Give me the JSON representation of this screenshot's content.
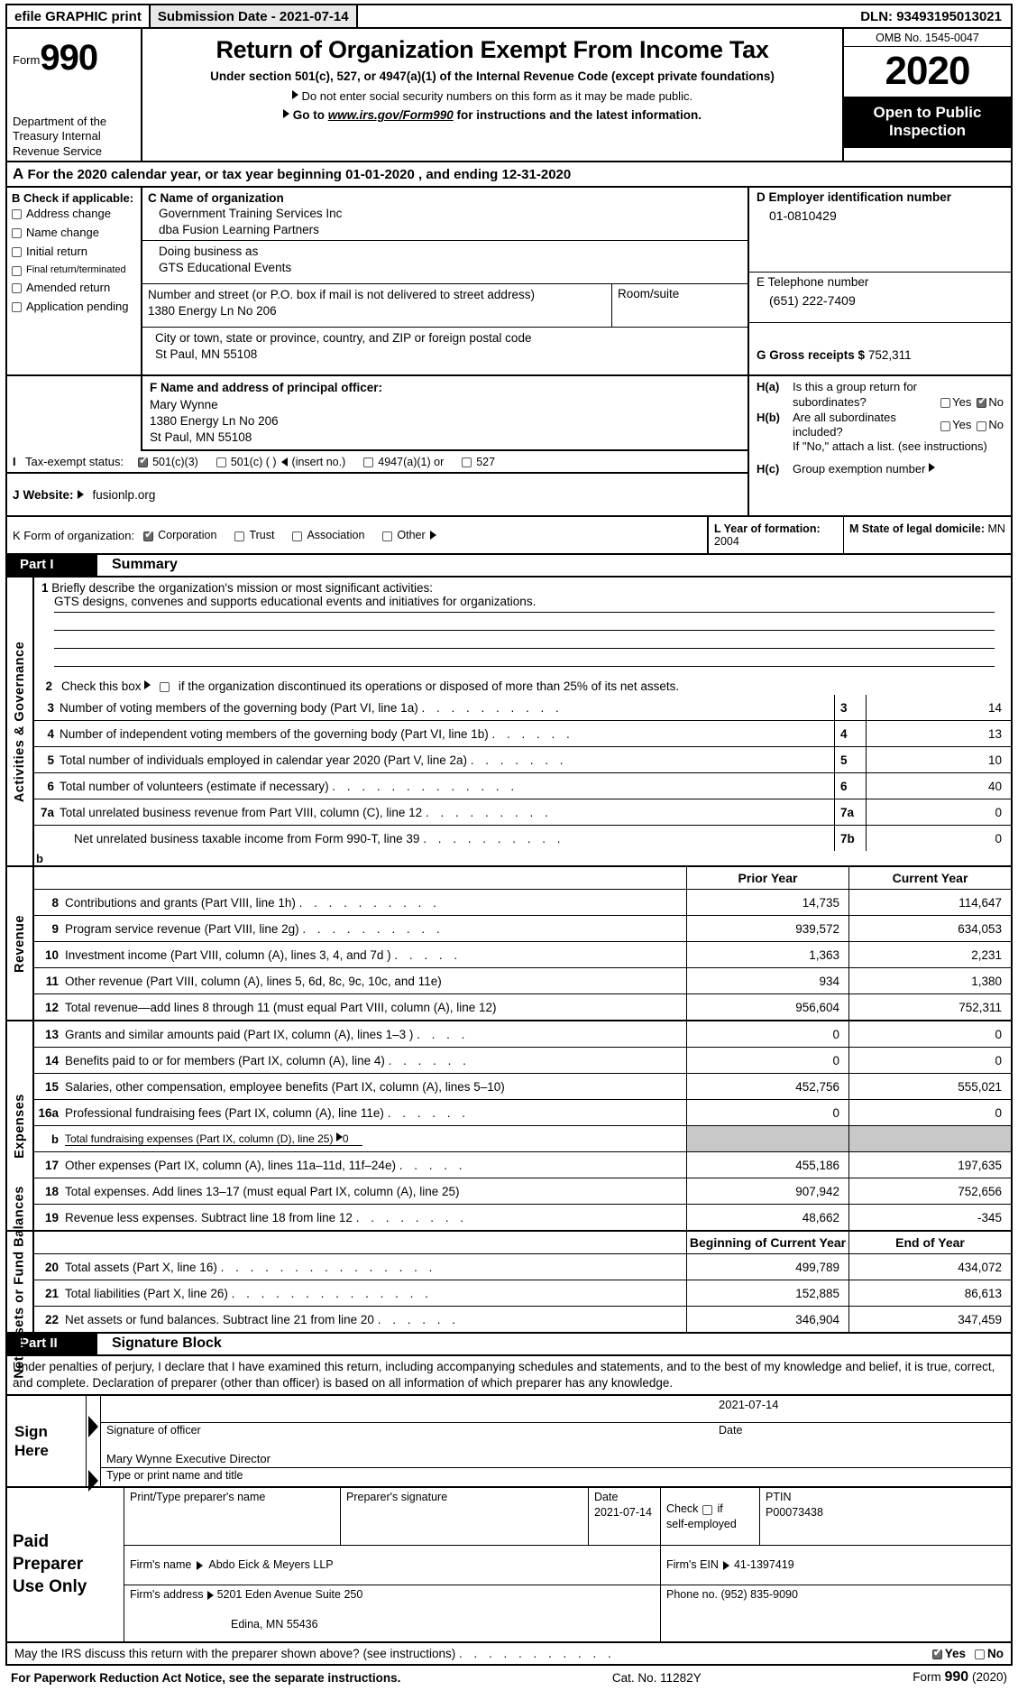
{
  "efile": {
    "graphic_print": "efile GRAPHIC print",
    "submission_date": "Submission Date - 2021-07-14",
    "dln": "DLN: 93493195013021"
  },
  "header": {
    "form_word": "Form",
    "form_number": "990",
    "department": "Department of the Treasury Internal Revenue Service",
    "title": "Return of Organization Exempt From Income Tax",
    "subtitle1": "Under section 501(c), 527, or 4947(a)(1) of the Internal Revenue Code (except private foundations)",
    "subtitle2": "Do not enter social security numbers on this form as it may be made public.",
    "subtitle3_pre": "Go to ",
    "subtitle3_link": "www.irs.gov/Form990",
    "subtitle3_post": " for instructions and the latest information.",
    "omb": "OMB No. 1545-0047",
    "year": "2020",
    "open_line1": "Open to Public",
    "open_line2": "Inspection"
  },
  "lineA": {
    "letter": "A",
    "text": "For the 2020 calendar year, or tax year beginning 01-01-2020   , and ending 12-31-2020"
  },
  "sectionB": {
    "heading": "B Check if applicable:",
    "items": [
      {
        "label": "Address change",
        "checked": false,
        "small": false
      },
      {
        "label": "Name change",
        "checked": false,
        "small": false
      },
      {
        "label": "Initial return",
        "checked": false,
        "small": false
      },
      {
        "label": "Final return/terminated",
        "checked": false,
        "small": true
      },
      {
        "label": "Amended return",
        "checked": false,
        "small": false
      },
      {
        "label": "Application pending",
        "checked": false,
        "small": false
      }
    ]
  },
  "sectionC": {
    "name_label": "C Name of organization",
    "name_value": "Government Training Services Inc",
    "name_value2": "dba Fusion Learning Partners",
    "dba_label": "Doing business as",
    "dba_value": "GTS Educational Events",
    "street_label": "Number and street (or P.O. box if mail is not delivered to street address)",
    "street_value": "1380 Energy Ln No 206",
    "room_label": "Room/suite",
    "room_value": "",
    "city_label": "City or town, state or province, country, and ZIP or foreign postal code",
    "city_value": "St Paul, MN  55108"
  },
  "sectionD": {
    "label": "D Employer identification number",
    "value": "01-0810429"
  },
  "sectionE": {
    "label": "E Telephone number",
    "value": "(651) 222-7409"
  },
  "sectionG": {
    "label": "G Gross receipts $",
    "value": "752,311"
  },
  "sectionF": {
    "label": "F  Name and address of principal officer:",
    "line1": "Mary Wynne",
    "line2": "1380 Energy Ln No 206",
    "line3": "St Paul, MN  55108"
  },
  "sectionH": {
    "a_tag": "H(a)",
    "a_text1": "Is this a group return for",
    "a_text2": "subordinates?",
    "a_yes": "Yes",
    "a_no": "No",
    "a_yes_checked": false,
    "a_no_checked": true,
    "b_tag": "H(b)",
    "b_text1": "Are all subordinates",
    "b_text2": "included?",
    "b_yes": "Yes",
    "b_no": "No",
    "b_yes_checked": false,
    "b_no_checked": false,
    "b_note": "If \"No,\" attach a list. (see instructions)",
    "c_tag": "H(c)",
    "c_text": "Group exemption number"
  },
  "sectionI": {
    "tag": "I",
    "label": "Tax-exempt status:",
    "options": [
      {
        "label": "501(c)(3)",
        "checked": true
      },
      {
        "label": "501(c) (  )",
        "checked": false,
        "suffix": "(insert no.)"
      },
      {
        "label": "4947(a)(1) or",
        "checked": false
      },
      {
        "label": "527",
        "checked": false
      }
    ]
  },
  "sectionJ": {
    "tag": "J",
    "label": "Website:",
    "value": "fusionlp.org"
  },
  "sectionK": {
    "label": "K Form of organization:",
    "options": [
      {
        "label": "Corporation",
        "checked": true
      },
      {
        "label": "Trust",
        "checked": false
      },
      {
        "label": "Association",
        "checked": false
      },
      {
        "label": "Other",
        "checked": false,
        "arrow": true
      }
    ]
  },
  "sectionL": {
    "label": "L Year of formation:",
    "value": "2004"
  },
  "sectionM": {
    "label": "M State of legal domicile:",
    "value": "MN"
  },
  "partI": {
    "part_label": "Part I",
    "title": "Summary",
    "side_label": "Activities & Governance",
    "line1_num": "1",
    "line1_label": "Briefly describe the organization's mission or most significant activities:",
    "line1_value": "GTS designs, convenes and supports educational events and initiatives for organizations.",
    "line2_num": "2",
    "line2_text_a": "Check this box",
    "line2_text_b": "if the organization discontinued its operations or disposed of more than 25% of its net assets.",
    "line2_checked": false,
    "rows": [
      {
        "num": "3",
        "text": "Number of voting members of the governing body (Part VI, line 1a)",
        "dots": ".  .  .  .  .  .  .  .  .  .",
        "key": "3",
        "value": "14"
      },
      {
        "num": "4",
        "text": "Number of independent voting members of the governing body (Part VI, line 1b)",
        "dots": ".  .  .  .  .  .",
        "key": "4",
        "value": "13"
      },
      {
        "num": "5",
        "text": "Total number of individuals employed in calendar year 2020 (Part V, line 2a)",
        "dots": ".  .  .  .  .  .  .",
        "key": "5",
        "value": "10"
      },
      {
        "num": "6",
        "text": "Total number of volunteers (estimate if necessary)",
        "dots": ".  .  .  .  .  .  .  .  .  .  .  .  .",
        "key": "6",
        "value": "40"
      },
      {
        "num": "7a",
        "text": "Total unrelated business revenue from Part VIII, column (C), line 12",
        "dots": ".  .  .  .  .  .  .  .  .",
        "key": "7a",
        "value": "0"
      },
      {
        "num": "",
        "text": "Net unrelated business taxable income from Form 990-T, line 39",
        "dots": ".  .  .  .  .  .  .  .  .  .",
        "key": "7b",
        "value": "0"
      }
    ],
    "orphan_b": "b"
  },
  "financials": {
    "col_prior": "Prior Year",
    "col_current": "Current Year",
    "col_begin": "Beginning of Current Year",
    "col_end": "End of Year",
    "revenue_side_label": "Revenue",
    "expenses_side_label": "Expenses",
    "netassets_side_label": "Net Assets or Fund Balances",
    "revenue_rows": [
      {
        "num": "8",
        "text": "Contributions and grants (Part VIII, line 1h)",
        "dots": ".  .  .  .  .  .  .  .  .  .",
        "prior": "14,735",
        "current": "114,647"
      },
      {
        "num": "9",
        "text": "Program service revenue (Part VIII, line 2g)",
        "dots": ".  .  .  .  .  .  .  .  .  .",
        "prior": "939,572",
        "current": "634,053"
      },
      {
        "num": "10",
        "text": "Investment income (Part VIII, column (A), lines 3, 4, and 7d )",
        "dots": ".  .  .  .  .",
        "prior": "1,363",
        "current": "2,231"
      },
      {
        "num": "11",
        "text": "Other revenue (Part VIII, column (A), lines 5, 6d, 8c, 9c, 10c, and 11e)",
        "dots": "",
        "prior": "934",
        "current": "1,380"
      },
      {
        "num": "12",
        "text": "Total revenue—add lines 8 through 11 (must equal Part VIII, column (A), line 12)",
        "dots": "",
        "prior": "956,604",
        "current": "752,311"
      }
    ],
    "expense_rows": [
      {
        "num": "13",
        "text": "Grants and similar amounts paid (Part IX, column (A), lines 1–3 )",
        "dots": ".  .  .  .",
        "prior": "0",
        "current": "0",
        "grey": false,
        "sub": false
      },
      {
        "num": "14",
        "text": "Benefits paid to or for members (Part IX, column (A), line 4)",
        "dots": ".  .  .  .  .  .",
        "prior": "0",
        "current": "0",
        "grey": false,
        "sub": false
      },
      {
        "num": "15",
        "text": "Salaries, other compensation, employee benefits (Part IX, column (A), lines 5–10)",
        "dots": "",
        "prior": "452,756",
        "current": "555,021",
        "grey": false,
        "sub": false
      },
      {
        "num": "16a",
        "text": "Professional fundraising fees (Part IX, column (A), line 11e)",
        "dots": ".  .  .  .  .  .",
        "prior": "0",
        "current": "0",
        "grey": false,
        "sub": false
      },
      {
        "num": "b",
        "text": "Total fundraising expenses (Part IX, column (D), line 25)",
        "dots": "",
        "prior": "",
        "current": "",
        "grey": true,
        "sub": true,
        "arrow_value": "0"
      },
      {
        "num": "17",
        "text": "Other expenses (Part IX, column (A), lines 11a–11d, 11f–24e)",
        "dots": ".  .  .  .  .",
        "prior": "455,186",
        "current": "197,635",
        "grey": false,
        "sub": false
      },
      {
        "num": "18",
        "text": "Total expenses. Add lines 13–17 (must equal Part IX, column (A), line 25)",
        "dots": "",
        "prior": "907,942",
        "current": "752,656",
        "grey": false,
        "sub": false
      },
      {
        "num": "19",
        "text": "Revenue less expenses. Subtract line 18 from line 12",
        "dots": ".  .  .  .  .  .  .  .",
        "prior": "48,662",
        "current": "-345",
        "grey": false,
        "sub": false
      }
    ],
    "netasset_rows": [
      {
        "num": "20",
        "text": "Total assets (Part X, line 16)",
        "dots": ".  .  .  .  .  .  .  .  .  .  .  .  .  .  .",
        "begin": "499,789",
        "end": "434,072"
      },
      {
        "num": "21",
        "text": "Total liabilities (Part X, line 26)",
        "dots": ".  .  .  .  .  .  .  .  .  .  .  .  .  .",
        "begin": "152,885",
        "end": "86,613"
      },
      {
        "num": "22",
        "text": "Net assets or fund balances. Subtract line 21 from line 20",
        "dots": ".  .  .  .  .  .",
        "begin": "346,904",
        "end": "347,459"
      }
    ]
  },
  "partII": {
    "part_label": "Part II",
    "title": "Signature Block",
    "perjury": "Under penalties of perjury, I declare that I have examined this return, including accompanying schedules and statements, and to the best of my knowledge and belief, it is true, correct, and complete. Declaration of preparer (other than officer) is based on all information of which preparer has any knowledge.",
    "sign_here_1": "Sign",
    "sign_here_2": "Here",
    "officer_signature_value": "",
    "officer_signature_caption": "Signature of officer",
    "date_value": "2021-07-14",
    "date_caption": "Date",
    "name_title_value": "Mary Wynne  Executive Director",
    "name_title_caption": "Type or print name and title"
  },
  "preparer": {
    "side_1": "Paid",
    "side_2": "Preparer",
    "side_3": "Use Only",
    "print_name_cap": "Print/Type preparer's name",
    "print_name_val": "",
    "signature_cap": "Preparer's signature",
    "signature_val": "",
    "date_cap": "Date",
    "date_val": "2021-07-14",
    "check_cap_1": "Check",
    "check_cap_2": "if",
    "check_cap_3": "self-employed",
    "check_checked": false,
    "ptin_cap": "PTIN",
    "ptin_val": "P00073438",
    "firm_name_cap": "Firm's name",
    "firm_name_val": "Abdo Eick & Meyers LLP",
    "firm_ein_cap": "Firm's EIN",
    "firm_ein_val": "41-1397419",
    "firm_addr_cap": "Firm's address",
    "firm_addr_val": "5201 Eden Avenue Suite 250",
    "firm_addr_val2": "Edina, MN  55436",
    "phone_cap": "Phone no.",
    "phone_val": "(952) 835-9090"
  },
  "footer": {
    "irs_question": "May the IRS discuss this return with the preparer shown above? (see instructions)",
    "irs_dots": ".  .  .  .  .  .  .  .  .  .  .",
    "yes": "Yes",
    "no": "No",
    "yes_checked": true,
    "no_checked": false,
    "paperwork": "For Paperwork Reduction Act Notice, see the separate instructions.",
    "cat_no": "Cat. No. 11282Y",
    "form_word": "Form",
    "form_number": "990",
    "form_year": "(2020)"
  }
}
